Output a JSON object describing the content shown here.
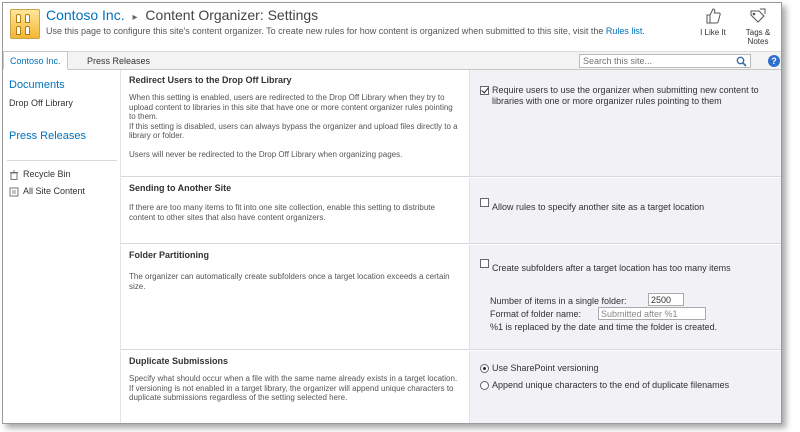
{
  "header": {
    "site_name": "Contoso Inc.",
    "breadcrumb_sep": "▸",
    "page_title": "Content Organizer: Settings",
    "description_prefix": "Use this page to configure this site's content organizer. To create new rules for how content is organized when submitted to this site, visit the",
    "description_link": "Rules list",
    "description_suffix": ".",
    "like_label": "I Like It",
    "tags_label_1": "Tags &",
    "tags_label_2": "Notes"
  },
  "topnav": {
    "tabs": [
      {
        "label": "Contoso Inc."
      },
      {
        "label": "Press Releases"
      }
    ],
    "search_placeholder": "Search this site...",
    "help_label": "?"
  },
  "leftnav": {
    "documents": "Documents",
    "drop_off": "Drop Off Library",
    "press_releases": "Press Releases",
    "recycle_bin": "Recycle Bin",
    "all_content": "All Site Content"
  },
  "sections": {
    "redirect": {
      "title": "Redirect Users to the Drop Off Library",
      "desc1": "When this setting is enabled, users are redirected to the Drop Off Library when they try to upload content to libraries in this site that have one or more content organizer rules pointing to them.",
      "desc2": "If this setting is disabled, users can always bypass the organizer and upload files directly to a library or folder.",
      "desc3": "Users will never be redirected to the Drop Off Library when organizing pages.",
      "option": "Require users to use the organizer when submitting new content to libraries with one or more organizer rules pointing to them"
    },
    "sending": {
      "title": "Sending to Another Site",
      "desc1": "If there are too many items to fit into one site collection, enable this setting to distribute content to other sites that also have content organizers.",
      "option": "Allow rules to specify another site as a target location"
    },
    "folder": {
      "title": "Folder Partitioning",
      "desc1": "The organizer can automatically create subfolders once a target location exceeds a certain size.",
      "option": "Create subfolders after a target location has too many items",
      "items_label": "Number of items in a single folder:",
      "items_value": "2500",
      "format_label": "Format of folder name:",
      "format_value": "Submitted after %1",
      "note": "%1 is replaced by the date and time the folder is created."
    },
    "duplicate": {
      "title": "Duplicate Submissions",
      "desc1": "Specify what should occur when a file with the same name already exists in a target location.",
      "desc2": "If versioning is not enabled in a target library, the organizer will append unique characters to duplicate submissions regardless of the setting selected here.",
      "option1": "Use SharePoint versioning",
      "option2": "Append unique characters to the end of duplicate filenames"
    }
  }
}
